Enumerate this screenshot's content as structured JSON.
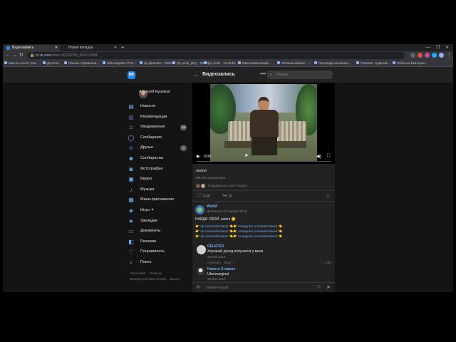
{
  "browser": {
    "tabs": [
      {
        "label": "Видеозапись",
        "active": true
      },
      {
        "label": "Новая вкладка",
        "active": false
      }
    ],
    "url": {
      "host": "m.vk.com",
      "path": "/video-30316056_456278989"
    },
    "bookmarks": [
      "Mail.Ru почта, пои...",
      "Десктоп",
      "Панель Управлени...",
      "Mila покупки / Fon...",
      "(3) jakerulev - Twitch",
      "(3) xochi_play - Twitch",
      "(3) xochi - YouTube",
      "https://www.donati...",
      "Личный кабинет -...",
      "Переводы на кошел...",
      "Главная - Единый...",
      "Работа в Екатерин..."
    ],
    "colors": {
      "accent": "#2787f5",
      "link": "#71aaeb",
      "bg": "#141414",
      "panel": "#222222"
    }
  },
  "vk": {
    "logo": "ВК",
    "title": "Видеозапись",
    "search_placeholder": "Поиск"
  },
  "sidebar": {
    "user": "Алексей Куряков",
    "items": [
      {
        "label": "Новости",
        "icon": "news-icon",
        "glyph": "▤",
        "count": ""
      },
      {
        "label": "Рекомендации",
        "icon": "compass-icon",
        "glyph": "◎",
        "count": ""
      },
      {
        "label": "Уведомления",
        "icon": "bell-icon",
        "glyph": "♫",
        "count": "46"
      },
      {
        "label": "Сообщения",
        "icon": "message-icon",
        "glyph": "◯",
        "count": ""
      },
      {
        "label": "Друзья",
        "icon": "friends-icon",
        "glyph": "☺",
        "count": "7"
      },
      {
        "label": "Сообщества",
        "icon": "communities-icon",
        "glyph": "☻",
        "count": ""
      },
      {
        "label": "Фотографии",
        "icon": "photo-icon",
        "glyph": "◙",
        "count": ""
      },
      {
        "label": "Видео",
        "icon": "video-icon",
        "glyph": "▣",
        "count": ""
      },
      {
        "label": "Музыка",
        "icon": "music-icon",
        "glyph": "♪",
        "count": ""
      },
      {
        "label": "Мини-приложения",
        "icon": "apps-icon",
        "glyph": "▦",
        "count": ""
      },
      {
        "label": "Игры ✦",
        "icon": "games-icon",
        "glyph": "◈",
        "count": ""
      },
      {
        "label": "Закладки",
        "icon": "bookmark-icon",
        "glyph": "★",
        "count": ""
      },
      {
        "label": "Документы",
        "icon": "document-icon",
        "glyph": "▭",
        "count": ""
      },
      {
        "label": "Реклама",
        "icon": "ads-icon",
        "glyph": "◧",
        "count": ""
      },
      {
        "label": "Понравилось",
        "icon": "heart-icon",
        "glyph": "♡",
        "count": ""
      },
      {
        "label": "Поиск",
        "icon": "search-icon",
        "glyph": "⌕",
        "count": ""
      }
    ],
    "footer": [
      {
        "left": "Настройки",
        "right": "Помощь"
      },
      {
        "left": "Версия для компьютера",
        "right": "Выход"
      }
    ]
  },
  "video": {
    "time": "0:00",
    "name": ".webm",
    "views": "389 346 просмотров",
    "liked_by": "Понравилось 3447 людям",
    "likes": "3,4K",
    "shares": "16"
  },
  "comments": [
    {
      "author": "WebM",
      "date": "Добавлено 20 января 2016",
      "text": "НАЙДИ СВОЙ .webm 😊",
      "links": [
        {
          "a": "vk.com/webmland",
          "b": "instagram.com/webmland"
        },
        {
          "a": "vk.com/webmland",
          "b": "instagram.com/webmland"
        },
        {
          "a": "vk.com/webmland",
          "b": "instagram.com/webmland"
        }
      ]
    },
    {
      "author": "DELETED",
      "text": "Хороший доход получится у меня",
      "date": "18 мая 2018",
      "reply": "Ответить",
      "more": "Ещё ⌄",
      "likes": "182"
    },
    {
      "author": "Никита Стевкин",
      "text": "Ubermarginal",
      "date": "18 мая 2018"
    }
  ],
  "composer": {
    "placeholder": "Комментарий"
  }
}
